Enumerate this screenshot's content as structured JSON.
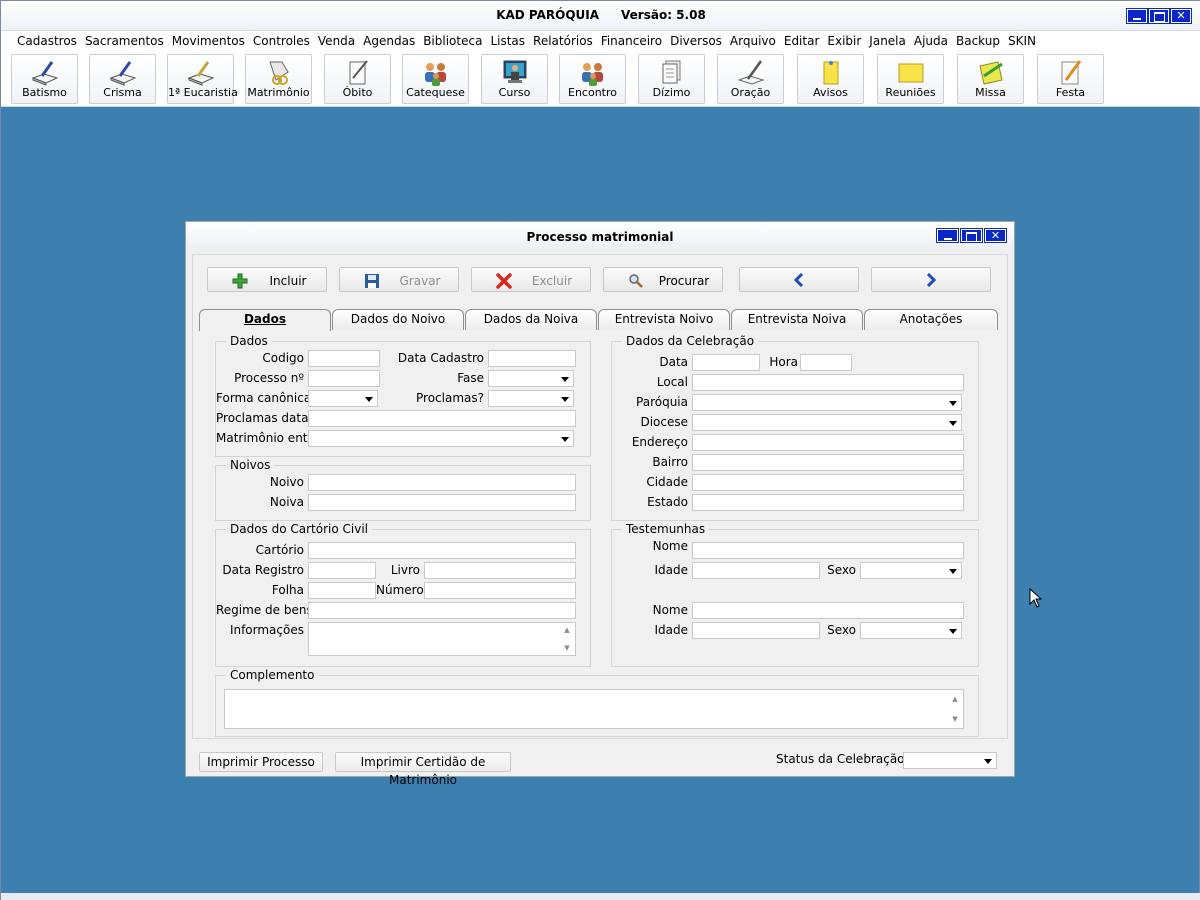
{
  "app": {
    "title": "KAD PARÓQUIA",
    "version": "Versão: 5.08"
  },
  "menu": [
    "Cadastros",
    "Sacramentos",
    "Movimentos",
    "Controles",
    "Venda",
    "Agendas",
    "Biblioteca",
    "Listas",
    "Relatórios",
    "Financeiro",
    "Diversos",
    "Arquivo",
    "Editar",
    "Exibir",
    "Janela",
    "Ajuda",
    "Backup",
    "SKIN"
  ],
  "toolbar": [
    {
      "label": "Batismo",
      "icon": "book-pen-icon"
    },
    {
      "label": "Crisma",
      "icon": "book-pen-icon"
    },
    {
      "label": "1ª Eucaristia",
      "icon": "book-pen-icon"
    },
    {
      "label": "Matrimônio",
      "icon": "rings-icon"
    },
    {
      "label": "Óbito",
      "icon": "document-pen-icon"
    },
    {
      "label": "Catequese",
      "icon": "people-icon"
    },
    {
      "label": "Curso",
      "icon": "monitor-person-icon"
    },
    {
      "label": "Encontro",
      "icon": "people-icon"
    },
    {
      "label": "Dízimo",
      "icon": "document-stack-icon"
    },
    {
      "label": "Oração",
      "icon": "pen-paper-icon"
    },
    {
      "label": "Avisos",
      "icon": "sticky-note-icon"
    },
    {
      "label": "Reuniões",
      "icon": "sticky-note-icon"
    },
    {
      "label": "Missa",
      "icon": "pencil-note-icon"
    },
    {
      "label": "Festa",
      "icon": "pencil-paper-icon"
    }
  ],
  "dialog": {
    "title": "Processo matrimonial",
    "actions": {
      "incluir": "Incluir",
      "gravar": "Gravar",
      "excluir": "Excluir",
      "procurar": "Procurar"
    },
    "tabs": [
      "Dados",
      "Dados do Noivo",
      "Dados da Noiva",
      "Entrevista Noivo",
      "Entrevista Noiva",
      "Anotações"
    ],
    "dados": {
      "legend": "Dados",
      "codigo": "Codigo",
      "data_cadastro": "Data Cadastro",
      "processo_n": "Processo nº",
      "fase": "Fase",
      "forma_canonica": "Forma canônica?",
      "proclamas": "Proclamas?",
      "proclamas_datas": "Proclamas datas",
      "matrimonio_entre": "Matrimônio entre"
    },
    "noivos": {
      "legend": "Noivos",
      "noivo": "Noivo",
      "noiva": "Noiva"
    },
    "cartorio": {
      "legend": "Dados do Cartório Civil",
      "cartorio": "Cartório",
      "data_registro": "Data Registro",
      "livro": "Livro",
      "folha": "Folha",
      "numero": "Número",
      "regime_bens": "Regime de bens",
      "informacoes": "Informações"
    },
    "celebracao": {
      "legend": "Dados da Celebração",
      "data": "Data",
      "hora": "Hora",
      "local": "Local",
      "paroquia": "Paróquia",
      "diocese": "Diocese",
      "endereco": "Endereço",
      "bairro": "Bairro",
      "cidade": "Cidade",
      "estado": "Estado"
    },
    "testemunhas": {
      "legend": "Testemunhas",
      "nome1": "Nome",
      "idade1": "Idade",
      "sexo1": "Sexo",
      "nome2": "Nome",
      "idade2": "Idade",
      "sexo2": "Sexo"
    },
    "complemento": {
      "legend": "Complemento"
    },
    "footer": {
      "imprimir_processo": "Imprimir Processo",
      "imprimir_certidao": "Imprimir Certidão de Matrimônio",
      "status_label": "Status da Celebração"
    }
  }
}
